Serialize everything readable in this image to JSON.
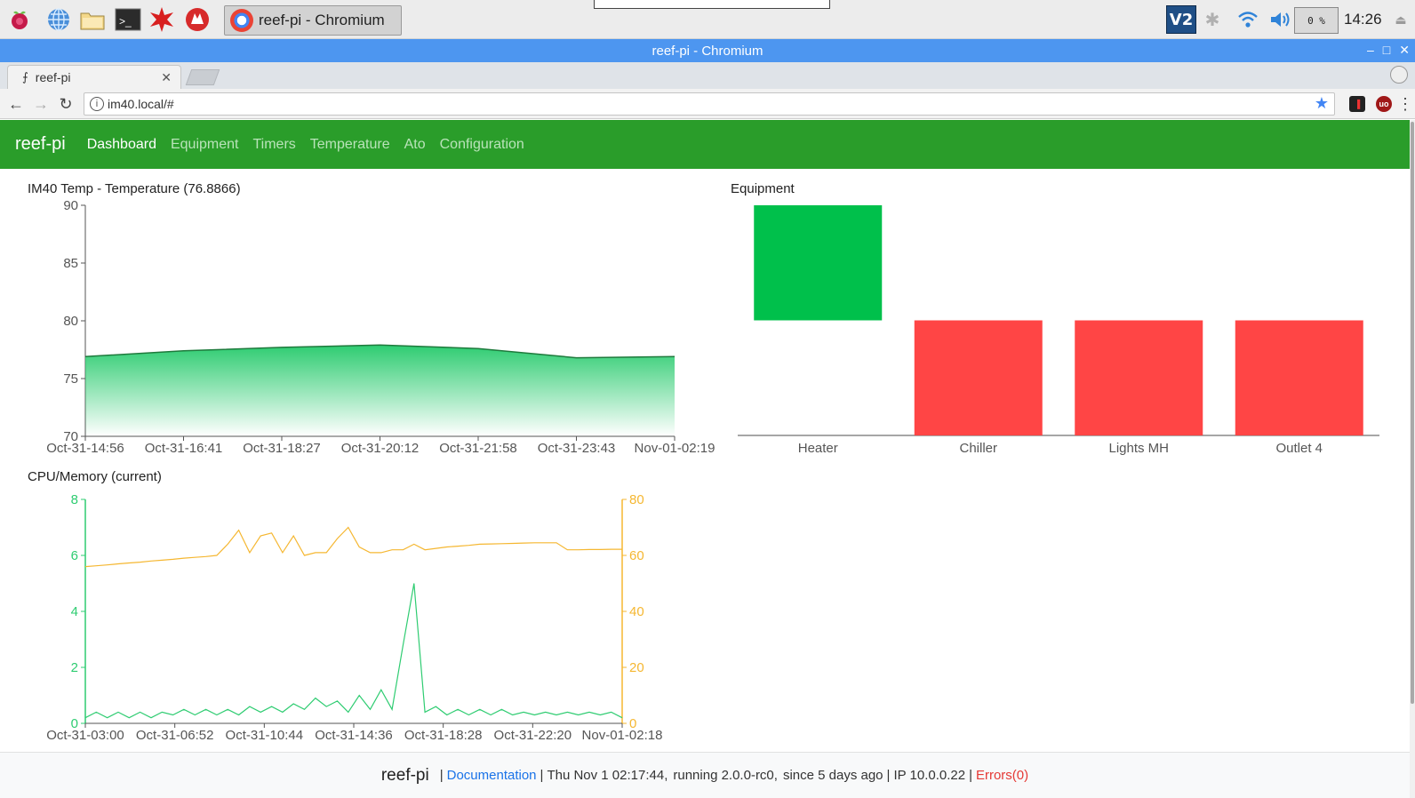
{
  "taskbar": {
    "task_label": "reef-pi - Chromium",
    "cpu_label": "0 %",
    "clock": "14:26"
  },
  "window": {
    "title": "reef-pi - Chromium"
  },
  "browser": {
    "tab_label": "reef-pi",
    "url": "im40.local/#"
  },
  "app": {
    "brand": "reef-pi",
    "nav": [
      {
        "label": "Dashboard",
        "active": true
      },
      {
        "label": "Equipment",
        "active": false
      },
      {
        "label": "Timers",
        "active": false
      },
      {
        "label": "Temperature",
        "active": false
      },
      {
        "label": "Ato",
        "active": false
      },
      {
        "label": "Configuration",
        "active": false
      }
    ]
  },
  "colors": {
    "nav_bg": "#2a9d2a",
    "equipment_on": "#00c04b",
    "equipment_off": "#ff4545",
    "cpu_line": "#2ecc71",
    "memory_line": "#f5b731",
    "temperature_area": "#2ecc71"
  },
  "chart_data": [
    {
      "type": "area",
      "title": "IM40 Temp - Temperature (76.8866)",
      "ylim": [
        70,
        90
      ],
      "yticks": [
        70,
        75,
        80,
        85,
        90
      ],
      "xticks": [
        "Oct-31-14:56",
        "Oct-31-16:41",
        "Oct-31-18:27",
        "Oct-31-20:12",
        "Oct-31-21:58",
        "Oct-31-23:43",
        "Nov-01-02:19"
      ],
      "x": [
        "Oct-31-14:56",
        "Oct-31-16:41",
        "Oct-31-18:27",
        "Oct-31-20:12",
        "Oct-31-21:58",
        "Oct-31-23:43",
        "Nov-01-02:19"
      ],
      "values": [
        76.9,
        77.4,
        77.7,
        77.9,
        77.6,
        76.8,
        76.9
      ]
    },
    {
      "type": "bar",
      "title": "Equipment",
      "categories": [
        "Heater",
        "Chiller",
        "Lights MH",
        "Outlet 4"
      ],
      "states": [
        1,
        0,
        0,
        0
      ]
    },
    {
      "type": "line",
      "title": "CPU/Memory (current)",
      "ylim_left": [
        0,
        8
      ],
      "yticks_left": [
        0,
        2,
        4,
        6,
        8
      ],
      "ylim_right": [
        0,
        80
      ],
      "yticks_right": [
        0,
        20,
        40,
        60,
        80
      ],
      "xticks": [
        "Oct-31-03:00",
        "Oct-31-06:52",
        "Oct-31-10:44",
        "Oct-31-14:36",
        "Oct-31-18:28",
        "Oct-31-22:20",
        "Nov-01-02:18"
      ],
      "series": [
        {
          "axis": "left",
          "values": [
            0.2,
            0.4,
            0.2,
            0.4,
            0.2,
            0.4,
            0.2,
            0.4,
            0.3,
            0.5,
            0.3,
            0.5,
            0.3,
            0.5,
            0.3,
            0.6,
            0.4,
            0.6,
            0.4,
            0.7,
            0.5,
            0.9,
            0.6,
            0.8,
            0.4,
            1.0,
            0.5,
            1.2,
            0.5,
            2.8,
            5.0,
            0.4,
            0.6,
            0.3,
            0.5,
            0.3,
            0.5,
            0.3,
            0.5,
            0.3,
            0.4,
            0.3,
            0.4,
            0.3,
            0.4,
            0.3,
            0.4,
            0.3,
            0.4,
            0.2
          ]
        },
        {
          "axis": "right",
          "values": [
            56,
            56.3,
            56.6,
            57,
            57.3,
            57.6,
            58,
            58.3,
            58.6,
            59,
            59.3,
            59.6,
            60,
            64,
            69,
            61,
            67,
            68,
            61,
            67,
            60,
            61,
            61,
            66,
            70,
            63,
            61,
            61,
            62,
            62,
            64,
            62,
            62.5,
            63,
            63.3,
            63.6,
            64,
            64.1,
            64.2,
            64.3,
            64.4,
            64.5,
            64.5,
            64.5,
            62,
            62,
            62.1,
            62.1,
            62.2,
            62.2
          ]
        }
      ]
    }
  ],
  "footer": {
    "brand": "reef-pi",
    "documentation": "Documentation",
    "date": "Thu Nov 1 02:17:44,",
    "running": "running 2.0.0-rc0,",
    "since": "since 5 days ago",
    "ip": "IP 10.0.0.22",
    "errors": "Errors(0)"
  }
}
